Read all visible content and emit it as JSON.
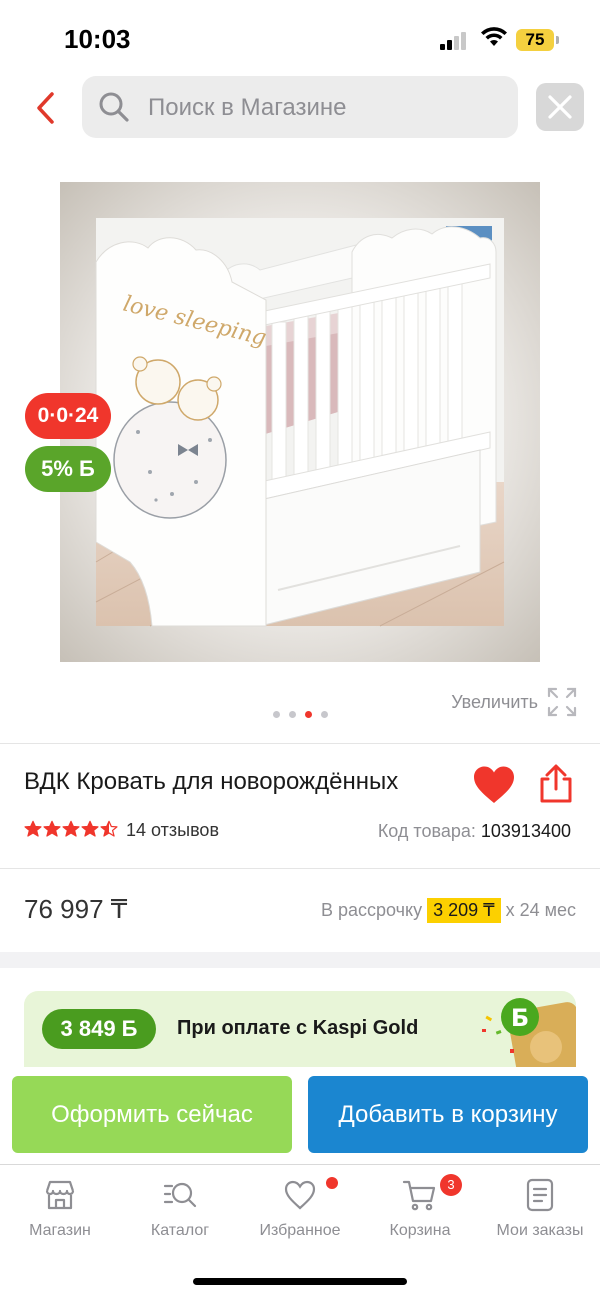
{
  "status_bar": {
    "time": "10:03",
    "battery": "75"
  },
  "search": {
    "placeholder": "Поиск в Магазине"
  },
  "gallery": {
    "badges": {
      "installment": "0·0·24",
      "bonus": "5% Б"
    },
    "zoom_label": "Увеличить",
    "image_count": 4,
    "active_image": 3,
    "image_lettering": "love sleeping"
  },
  "product": {
    "title": "ВДК Кровать для новорождённых",
    "rating": 4.5,
    "reviews": "14 отзывов",
    "sku_label": "Код товара:",
    "sku": "103913400",
    "price": "76 997 ₸",
    "installment_label": "В рассрочку",
    "installment_amount": "3 209 ₸",
    "installment_term": "х 24 мес"
  },
  "kaspi_gold": {
    "bonus": "3 849 Б",
    "text": "При оплате с Kaspi Gold",
    "art_letter": "Б"
  },
  "actions": {
    "checkout": "Оформить сейчас",
    "add_to_cart": "Добавить в корзину"
  },
  "tab_bar": {
    "tabs": [
      {
        "label": "Магазин",
        "icon": "store-icon"
      },
      {
        "label": "Каталог",
        "icon": "catalog-search-icon"
      },
      {
        "label": "Избранное",
        "icon": "heart-outline-icon",
        "dot": true
      },
      {
        "label": "Корзина",
        "icon": "cart-icon",
        "count": "3"
      },
      {
        "label": "Мои заказы",
        "icon": "orders-list-icon"
      }
    ]
  },
  "colors": {
    "accent_red": "#f0362c",
    "kaspi_green": "#5aa52a",
    "checkout_green": "#96d957",
    "cart_blue": "#1b86d0",
    "installment_yellow": "#fcd000"
  }
}
